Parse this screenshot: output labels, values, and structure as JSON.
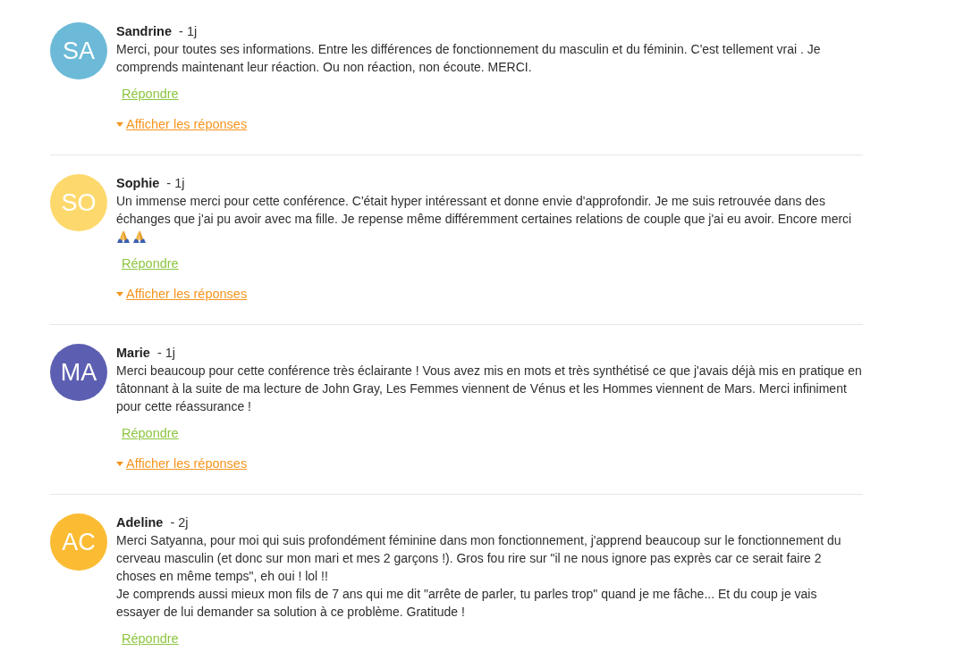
{
  "comments": [
    {
      "initials": "SA",
      "color": "#6cbad8",
      "author": "Sandrine",
      "time": "- 1j",
      "paragraphs": [
        "Merci, pour toutes ses informations. Entre les différences de fonctionnement du masculin et du féminin. C'est tellement vrai . Je comprends maintenant leur réaction. Ou non réaction, non écoute. MERCI."
      ],
      "reply_link": "Répondre",
      "replies_link": "Afficher les réponses"
    },
    {
      "initials": "SO",
      "color": "#fdd96d",
      "author": "Sophie",
      "time": "- 1j",
      "paragraphs": [
        "Un immense merci pour cette conférence. C'était hyper intéressant et donne envie d'approfondir. Je me suis retrouvée dans des échanges que j'ai pu avoir avec ma fille. Je repense même différemment certaines relations de couple que j'ai eu avoir. Encore merci"
      ],
      "icons": [
        {
          "kind": "prayer"
        },
        {
          "kind": "prayer"
        }
      ],
      "reply_link": "Répondre",
      "replies_link": "Afficher les réponses"
    },
    {
      "initials": "MA",
      "color": "#5c5fb1",
      "author": "Marie",
      "time": "- 1j",
      "paragraphs": [
        "Merci beaucoup pour cette conférence très éclairante ! Vous avez mis en mots et très synthétisé ce que j'avais déjà mis en pratique en tâtonnant à la suite de ma lecture de John Gray, Les Femmes viennent de Vénus et les Hommes viennent de Mars. Merci infiniment pour cette réassurance !"
      ],
      "reply_link": "Répondre",
      "replies_link": "Afficher les réponses"
    },
    {
      "initials": "AC",
      "color": "#fbbc34",
      "author": "Adeline",
      "time": "- 2j",
      "paragraphs": [
        "Merci Satyanna, pour moi qui suis profondément féminine dans mon fonctionnement, j'apprend beaucoup sur le fonctionnement du cerveau masculin (et donc sur mon mari et mes 2 garçons !). Gros fou rire sur \"il ne nous ignore pas exprès car ce serait faire 2 choses en même temps\", eh oui ! lol !!",
        "Je comprends aussi mieux mon fils de 7 ans qui me dit \"arrête de parler, tu parles trop\" quand je me fâche... Et du coup je vais essayer de lui demander sa solution à ce problème. Gratitude !"
      ],
      "reply_link": "Répondre"
    }
  ]
}
